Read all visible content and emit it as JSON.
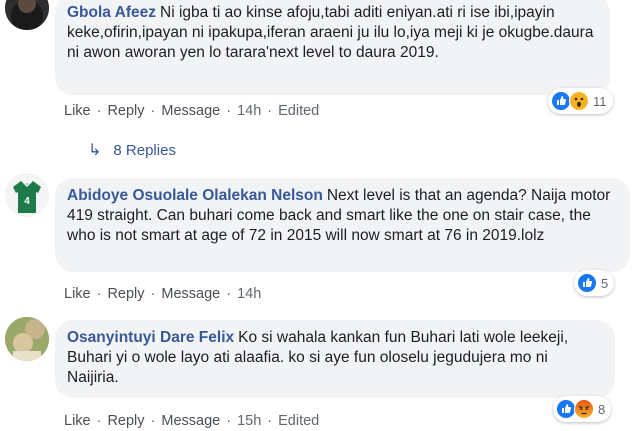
{
  "comments": [
    {
      "author": "Gbola Afeez",
      "text": "Ni igba ti ao kinse afoju,tabi aditi eniyan.ati ri ise ibi,ipayin keke,ofirin,ipayan ni ipakupa,iferan araeni ju ilu lo,iya meji ki je okugbe.daura ni awon aworan yen lo tarara'next level to daura 2019.",
      "actions": {
        "like": "Like",
        "reply": "Reply",
        "message": "Message",
        "time": "14h",
        "edited": "Edited"
      },
      "reactions": {
        "icons": [
          "like-icon",
          "wow-icon"
        ],
        "count": "11"
      },
      "replies": "8 Replies"
    },
    {
      "author": "Abidoye Osuolale Olalekan Nelson",
      "text": "Next level is that an agenda? Naija motor 419 straight. Can buhari come back and smart like the one on stair case, the who is not smart at age of 72 in 2015 will now smart at 76 in 2019.lolz",
      "actions": {
        "like": "Like",
        "reply": "Reply",
        "message": "Message",
        "time": "14h"
      },
      "reactions": {
        "icons": [
          "like-icon"
        ],
        "count": "5"
      }
    },
    {
      "author": "Osanyintuyi Dare Felix",
      "text": "Ko si wahala kankan fun Buhari lati wole leekeji, Buhari yi o wole layo ati alaafia. ko si aye fun oloselu jegudujera mo ni Naijiria.",
      "actions": {
        "like": "Like",
        "reply": "Reply",
        "message": "Message",
        "time": "15h",
        "edited": "Edited"
      },
      "reactions": {
        "icons": [
          "like-icon",
          "angry-icon"
        ],
        "count": "8"
      }
    }
  ],
  "avatar_jersey_number": "4",
  "colors": {
    "link": "#385898",
    "bubble": "#f2f3f5",
    "meta": "#606770",
    "like_blue": "#1877f2"
  }
}
